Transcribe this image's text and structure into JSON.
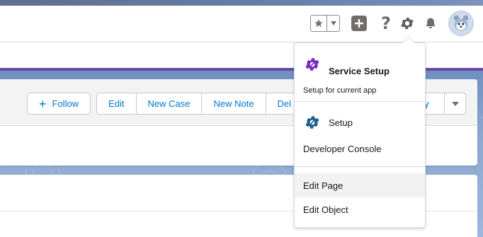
{
  "header": {
    "icons": [
      "star-icon",
      "chevron-down-icon",
      "plus-icon",
      "help-icon",
      "gear-icon",
      "bell-icon",
      "avatar"
    ],
    "help_glyph": "?"
  },
  "record_actions": {
    "follow_label": "Follow",
    "buttons": [
      "Edit",
      "New Case",
      "New Note",
      "Del"
    ],
    "tail_label": "ny"
  },
  "setup_menu": {
    "service_setup_title": "Service Setup",
    "service_setup_subtitle": "Setup for current app",
    "setup_label": "Setup",
    "developer_console_label": "Developer Console",
    "edit_page_label": "Edit Page",
    "edit_object_label": "Edit Object"
  },
  "colors": {
    "brand_blue": "#0176d3",
    "service_purple": "#7526c4",
    "setup_teal": "#1b5f8c",
    "icon_gray": "#706e6b",
    "band_purple": "#6b46a8"
  }
}
